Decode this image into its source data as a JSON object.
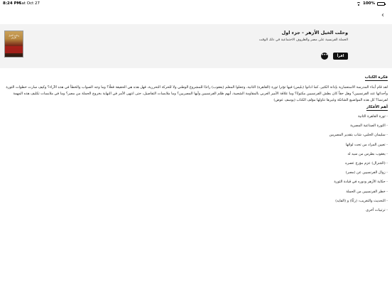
{
  "status_bar": {
    "time": "8:24 PM",
    "date": "Sat Oct 27",
    "battery": "100%",
    "icons": [
      "wifi-icon",
      "battery-icon"
    ]
  },
  "nav": {
    "back_icon": "‹"
  },
  "book": {
    "title": "وحلت الخيل الأزهر - جزء اول",
    "subtitle": "الحملة الفرنسية على مصر والظروف الاجتماعية في ذلك الوقت",
    "cover_title": "وحلت الخيل الأزهر",
    "read_label": "اقرأ",
    "more_label": "•••"
  },
  "summary": {
    "heading": "فكرة الكتاب",
    "text": "لقد قام أبناء المدرسة الاستعمارية بإدانة الكثير، كما ادانوا (بليس) فيها تؤثرا ثورة (القاهرة) الثانية، وجعلوا المعلم (يعقوب) رائدًا للمشروع الوطني ولا للحركة التحررية، فهل هذه هي الحقيقة فعلًا؟ وما وجه الصواب والخطأ في هذه الآراء؟ وكيف سارت خطوات الثورة وأحداثها عند الفرنسيين؟ وهل حقاً كان بطش الفرنسيين مكتوبًا؟ وما علاقة الأمير العربي بالمقاومة الشعبية، أيهم ظلم الفرنسيين وأيها المصريين؟ وما ملابسات التفاصيل، حتى انتهى الأمر في النهاية بخروج الحملة من مصر؟ وما في ملابسات تكليف هذه المهمة لفرنسا؟ كل هذه المواضيع الشائكة وغيرها تناولها مؤلف الكتاب (يوسف عوض)"
  },
  "events": {
    "heading": "أهم الأفكار",
    "items": [
      "ثورة القاهرة الثانية",
      "الثورة الصناعية المصرية",
      "سليمان الحلبي: شاب بتقدير المصريين",
      "تعيين المراد من تحت لوائها",
      "يعقوب بطرس من سيد له",
      "(الجنرال) عزم مؤرخ عصره",
      "زوال الفرنسيين عن (مصر)",
      "حكاية الأزهر ودوره في قيادة الثورة",
      "خطر الفرنسيين من الحملة",
      "التحديث والتغريب: (ركًا) و (الفايد)",
      "ترتيبات أخرى"
    ]
  }
}
